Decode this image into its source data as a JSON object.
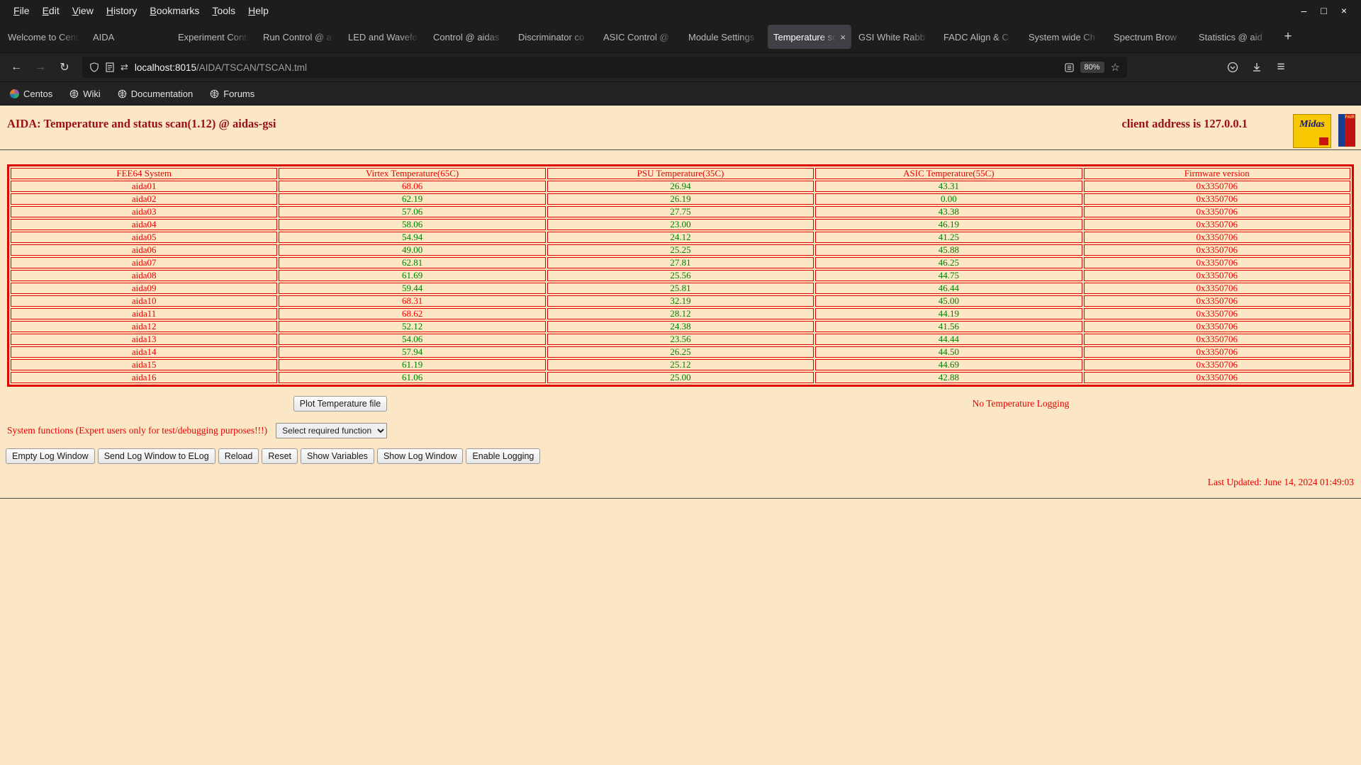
{
  "colors": {
    "page_bg": "#fbe7c5",
    "title_maroon": "#9a1010",
    "table_red": "#e80000",
    "ok_green": "#008000",
    "alarm_red": "#ff0000",
    "border_red": "#dd0000"
  },
  "browser": {
    "menu_items": [
      "File",
      "Edit",
      "View",
      "History",
      "Bookmarks",
      "Tools",
      "Help"
    ],
    "window_controls": {
      "minimize": "–",
      "maximize": "□",
      "close": "×"
    },
    "tabs": [
      {
        "label": "Welcome to Cent",
        "active": false
      },
      {
        "label": "AIDA",
        "active": false
      },
      {
        "label": "Experiment Cont",
        "active": false
      },
      {
        "label": "Run Control @ a",
        "active": false
      },
      {
        "label": "LED and Wavefo",
        "active": false
      },
      {
        "label": "Control @ aidas",
        "active": false
      },
      {
        "label": "Discriminator co",
        "active": false
      },
      {
        "label": "ASIC Control @",
        "active": false
      },
      {
        "label": "Module Settings",
        "active": false
      },
      {
        "label": "Temperature sc",
        "active": true
      },
      {
        "label": "GSI White Rabb",
        "active": false
      },
      {
        "label": "FADC Align & C",
        "active": false
      },
      {
        "label": "System wide Ch",
        "active": false
      },
      {
        "label": "Spectrum Brow",
        "active": false
      },
      {
        "label": "Statistics @ aid",
        "active": false
      }
    ],
    "new_tab_button": "+",
    "toolbar": {
      "back_icon": "←",
      "forward_icon": "→",
      "reload_icon": "↻",
      "permissions_icon": "⇄",
      "url_host": "localhost:8015",
      "url_path": "/AIDA/TSCAN/TSCAN.tml",
      "zoom_level": "80%",
      "star_icon": "☆",
      "menu_icon": "≡"
    },
    "bookmarks": [
      {
        "label": "Centos",
        "icon": "centos"
      },
      {
        "label": "Wiki",
        "icon": "globe"
      },
      {
        "label": "Documentation",
        "icon": "globe"
      },
      {
        "label": "Forums",
        "icon": "globe"
      }
    ]
  },
  "page": {
    "title": "AIDA: Temperature and status scan(1.12) @ aidas-gsi",
    "client_address": "client address is 127.0.0.1",
    "logos": {
      "midas_text": "Midas",
      "fair_text": "FAIR"
    },
    "table": {
      "headers": [
        "FEE64 System",
        "Virtex Temperature(65C)",
        "PSU Temperature(35C)",
        "ASIC Temperature(55C)",
        "Firmware version"
      ],
      "limits": {
        "virtex": 65,
        "psu": 35,
        "asic": 55
      },
      "rows": [
        {
          "system": "aida01",
          "virtex": "68.06",
          "psu": "26.94",
          "asic": "43.31",
          "firmware": "0x3350706"
        },
        {
          "system": "aida02",
          "virtex": "62.19",
          "psu": "26.19",
          "asic": "0.00",
          "firmware": "0x3350706"
        },
        {
          "system": "aida03",
          "virtex": "57.06",
          "psu": "27.75",
          "asic": "43.38",
          "firmware": "0x3350706"
        },
        {
          "system": "aida04",
          "virtex": "58.06",
          "psu": "23.00",
          "asic": "46.19",
          "firmware": "0x3350706"
        },
        {
          "system": "aida05",
          "virtex": "54.94",
          "psu": "24.12",
          "asic": "41.25",
          "firmware": "0x3350706"
        },
        {
          "system": "aida06",
          "virtex": "49.00",
          "psu": "25.25",
          "asic": "45.88",
          "firmware": "0x3350706"
        },
        {
          "system": "aida07",
          "virtex": "62.81",
          "psu": "27.81",
          "asic": "46.25",
          "firmware": "0x3350706"
        },
        {
          "system": "aida08",
          "virtex": "61.69",
          "psu": "25.56",
          "asic": "44.75",
          "firmware": "0x3350706"
        },
        {
          "system": "aida09",
          "virtex": "59.44",
          "psu": "25.81",
          "asic": "46.44",
          "firmware": "0x3350706"
        },
        {
          "system": "aida10",
          "virtex": "68.31",
          "psu": "32.19",
          "asic": "45.00",
          "firmware": "0x3350706"
        },
        {
          "system": "aida11",
          "virtex": "68.62",
          "psu": "28.12",
          "asic": "44.19",
          "firmware": "0x3350706"
        },
        {
          "system": "aida12",
          "virtex": "52.12",
          "psu": "24.38",
          "asic": "41.56",
          "firmware": "0x3350706"
        },
        {
          "system": "aida13",
          "virtex": "54.06",
          "psu": "23.56",
          "asic": "44.44",
          "firmware": "0x3350706"
        },
        {
          "system": "aida14",
          "virtex": "57.94",
          "psu": "26.25",
          "asic": "44.50",
          "firmware": "0x3350706"
        },
        {
          "system": "aida15",
          "virtex": "61.19",
          "psu": "25.12",
          "asic": "44.69",
          "firmware": "0x3350706"
        },
        {
          "system": "aida16",
          "virtex": "61.06",
          "psu": "25.00",
          "asic": "42.88",
          "firmware": "0x3350706"
        }
      ]
    },
    "plot_button_label": "Plot Temperature file",
    "logging_status": "No Temperature Logging",
    "system_functions_label": "System functions (Expert users only for test/debugging purposes!!!)",
    "function_select_value": "Select required function",
    "action_buttons": [
      "Empty Log Window",
      "Send Log Window to ELog",
      "Reload",
      "Reset",
      "Show Variables",
      "Show Log Window",
      "Enable Logging"
    ],
    "last_updated": "Last Updated: June 14, 2024 01:49:03"
  }
}
